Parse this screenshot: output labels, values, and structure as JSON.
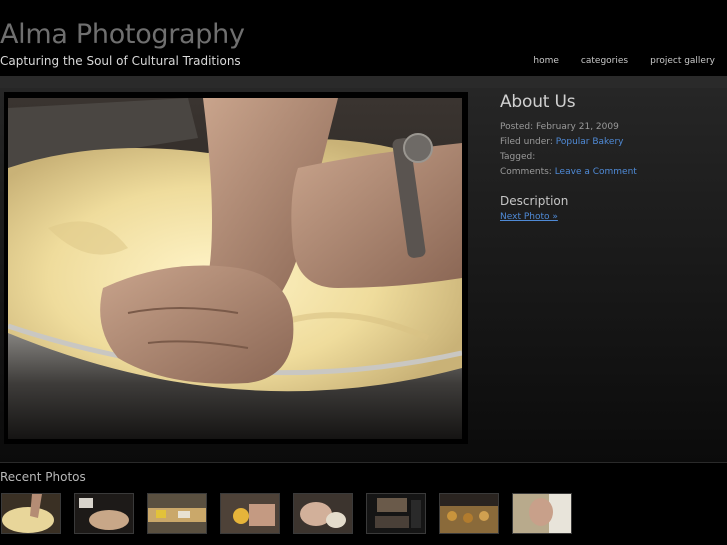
{
  "site": {
    "title": "Alma Photography",
    "tagline": "Capturing the Soul of Cultural Traditions"
  },
  "nav": {
    "items": [
      "home",
      "categories",
      "project gallery"
    ]
  },
  "post": {
    "photo_alt": "Hands kneading dough in a metal bowl"
  },
  "about": {
    "heading": "About Us",
    "posted_label": "Posted:",
    "posted_date": "February 21, 2009",
    "filed_label": "Filed under:",
    "filed_category": "Popular Bakery",
    "tagged_label": "Tagged:",
    "comments_label": "Comments:",
    "comments_link": "Leave a Comment",
    "description_heading": "Description",
    "next_photo": "Next Photo »"
  },
  "recent": {
    "title": "Recent Photos",
    "thumbs": [
      "thumb-1",
      "thumb-2",
      "thumb-3",
      "thumb-4",
      "thumb-5",
      "thumb-6",
      "thumb-7",
      "thumb-8"
    ]
  },
  "colors": {
    "link": "#4f8ad6",
    "background": "#000000",
    "title_gray": "#6f6f6f"
  }
}
